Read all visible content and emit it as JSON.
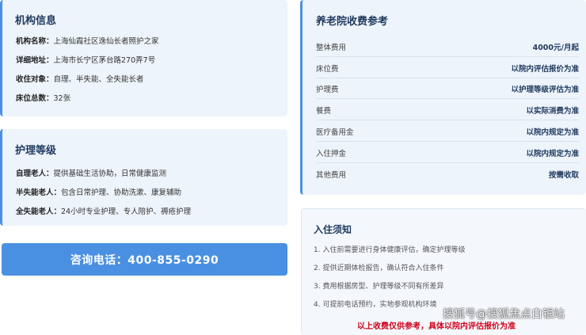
{
  "info": {
    "title": "机构信息",
    "rows": [
      {
        "label": "机构名称：",
        "value": "上海仙霞社区逸仙长者照护之家"
      },
      {
        "label": "详细地址：",
        "value": "上海市长宁区茅台路270弄7号"
      },
      {
        "label": "收住对象：",
        "value": "自理、半失能、全失能长者"
      },
      {
        "label": "床位总数：",
        "value": "32张"
      }
    ]
  },
  "care": {
    "title": "护理等级",
    "rows": [
      {
        "label": "自理老人：",
        "value": "提供基础生活协助，日常健康监测"
      },
      {
        "label": "半失能老人：",
        "value": "包含日常护理、协助洗漱、康复辅助"
      },
      {
        "label": "全失能老人：",
        "value": "24小时专业护理、专人陪护、褥疮护理"
      }
    ]
  },
  "phone": {
    "label": "咨询电话：400-855-0290"
  },
  "fees": {
    "title": "养老院收费参考",
    "rows": [
      {
        "label": "整体费用",
        "value": "4000元/月起"
      },
      {
        "label": "床位费",
        "value": "以院内评估报价为准"
      },
      {
        "label": "护理费",
        "value": "以护理等级评估为准"
      },
      {
        "label": "餐费",
        "value": "以实际消费为准"
      },
      {
        "label": "医疗备用金",
        "value": "以院内规定为准"
      },
      {
        "label": "入住押金",
        "value": "以院内规定为准"
      },
      {
        "label": "其他费用",
        "value": "按需收取"
      }
    ]
  },
  "notice": {
    "title": "入住须知",
    "items": [
      "1. 入住前需要进行身体健康评估，确定护理等级",
      "2. 提供近期体检报告，确认符合入住条件",
      "3. 费用根据房型、护理等级不同有所差异",
      "4. 可提前电话预约，实地参观机构环境"
    ],
    "warning": "以上收费仅供参考，具体以院内评估报价为准"
  },
  "watermark": "搜狐号@搜狐焦点白银站",
  "colors": {
    "accent": "#4a90e2",
    "title": "#1f3a5f",
    "warning": "#d0021b"
  }
}
